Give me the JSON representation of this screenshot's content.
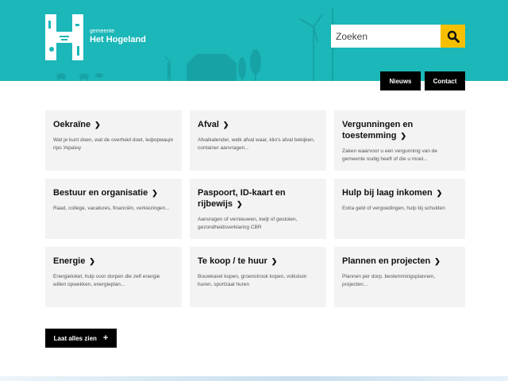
{
  "brand": {
    "small": "gemeente",
    "name": "Het Hogeland"
  },
  "search": {
    "placeholder": "Zoeken"
  },
  "nav": {
    "news": "Nieuws",
    "contact": "Contact"
  },
  "cards": [
    {
      "title": "Oekraïne",
      "desc": "Wat je kunt doen, wat de overheid doet, Інформація про Україну"
    },
    {
      "title": "Afval",
      "desc": "Afvalkalender, welk afval waar, kilo's afval bekijken, container aanvragen..."
    },
    {
      "title": "Vergunningen en toestemming",
      "desc": "Zaken waarvoor u een vergunning van de gemeente nodig heeft of die u moet..."
    },
    {
      "title": "Bestuur en organisatie",
      "desc": "Raad, college, vacatures, financiën, verkiezingen..."
    },
    {
      "title": "Paspoort, ID-kaart en rijbewijs",
      "desc": "Aanvragen of vernieuwen, kwijt of gestolen, gezondheidsverklaring CBR"
    },
    {
      "title": "Hulp bij laag inkomen",
      "desc": "Extra geld of vergoedingen, hulp bij schulden"
    },
    {
      "title": "Energie",
      "desc": "Energieloket, hulp voor dorpen die zelf energie willen opwekken, energieplan..."
    },
    {
      "title": "Te koop / te huur",
      "desc": "Bouwkavel kopen, groenstrook kopen, volkstuin huren, sportzaal huren"
    },
    {
      "title": "Plannen en projecten",
      "desc": "Plannen per dorp, bestemmingsplannen, projecten..."
    }
  ],
  "show_all": "Laat alles zien",
  "colors": {
    "header": "#1bb7b9",
    "accent": "#f6c000",
    "card": "#f3f3f3"
  }
}
